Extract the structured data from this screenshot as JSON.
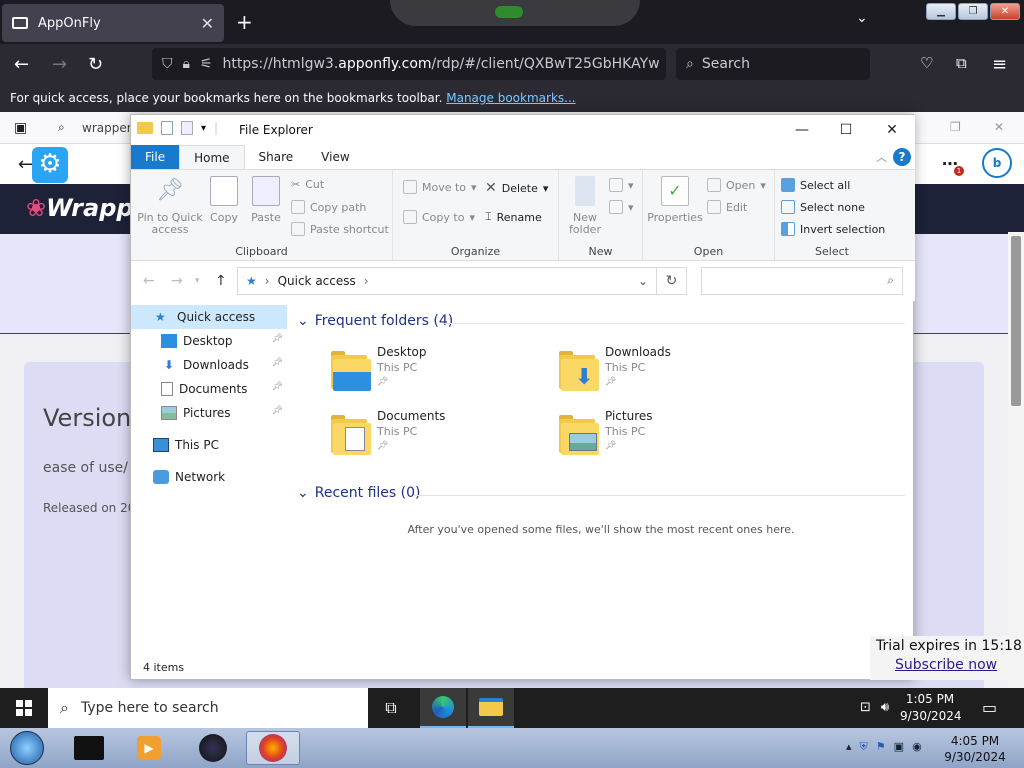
{
  "browser": {
    "tab_title": "AppOnFly",
    "url_prefix": "https://htmlgw3.",
    "url_host": "apponfly.com",
    "url_rest": "/rdp/#/client/QXBwT25GbHKAYw",
    "search_placeholder": "Search",
    "bookmark_hint": "For quick access, place your bookmarks here on the bookmarks toolbar.",
    "manage_bookmarks": "Manage bookmarks..."
  },
  "inner_tab": {
    "label": "wrapper"
  },
  "page": {
    "version_heading": "Version",
    "ease_text": "ease of use/",
    "released_text": "Released on 20"
  },
  "explorer": {
    "title": "File Explorer",
    "ribbon_tabs": [
      "File",
      "Home",
      "Share",
      "View"
    ],
    "clipboard": {
      "pin": "Pin to Quick access",
      "copy": "Copy",
      "paste": "Paste",
      "cut": "Cut",
      "copy_path": "Copy path",
      "paste_shortcut": "Paste shortcut",
      "label": "Clipboard"
    },
    "organize": {
      "move_to": "Move to",
      "copy_to": "Copy to",
      "delete": "Delete",
      "rename": "Rename",
      "label": "Organize"
    },
    "new": {
      "new_folder": "New folder",
      "label": "New"
    },
    "open": {
      "properties": "Properties",
      "open": "Open",
      "edit": "Edit",
      "label": "Open"
    },
    "select": {
      "select_all": "Select all",
      "select_none": "Select none",
      "invert": "Invert selection",
      "label": "Select"
    },
    "breadcrumb": "Quick access",
    "nav": {
      "quick_access": "Quick access",
      "items": [
        "Desktop",
        "Downloads",
        "Documents",
        "Pictures"
      ],
      "this_pc": "This PC",
      "network": "Network"
    },
    "frequent_header": "Frequent folders (4)",
    "folders": [
      {
        "name": "Desktop",
        "location": "This PC"
      },
      {
        "name": "Downloads",
        "location": "This PC"
      },
      {
        "name": "Documents",
        "location": "This PC"
      },
      {
        "name": "Pictures",
        "location": "This PC"
      }
    ],
    "recent_header": "Recent files (0)",
    "recent_empty": "After you've opened some files, we'll show the most recent ones here.",
    "status": "4 items"
  },
  "trial": {
    "expires": "Trial expires in 15:18",
    "subscribe": "Subscribe now"
  },
  "taskbar": {
    "search_placeholder": "Type here to search",
    "time": "1:05 PM",
    "date": "9/30/2024"
  },
  "host_taskbar": {
    "time": "4:05 PM",
    "date": "9/30/2024"
  },
  "colors": {
    "accent": "#1979ca",
    "link": "#1e3287",
    "selected": "#cce8ff"
  }
}
